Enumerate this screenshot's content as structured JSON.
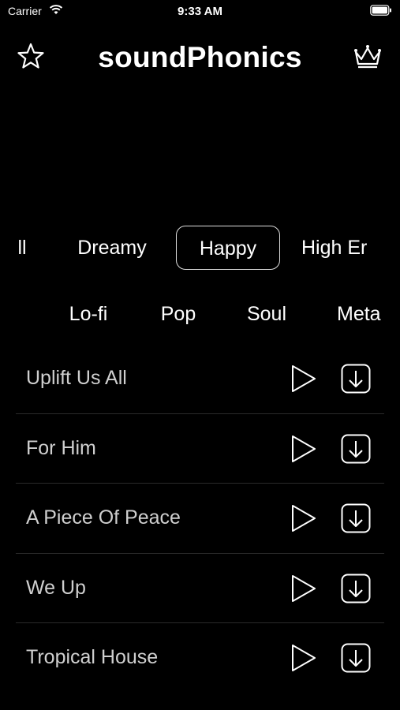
{
  "status": {
    "carrier": "Carrier",
    "time": "9:33 AM"
  },
  "header": {
    "title": "soundPhonics"
  },
  "genres_row1": [
    {
      "label": "ll"
    },
    {
      "label": "Dreamy"
    },
    {
      "label": "Happy",
      "selected": true
    },
    {
      "label": "High Er"
    }
  ],
  "genres_row2": [
    {
      "label": "Lo-fi"
    },
    {
      "label": "Pop"
    },
    {
      "label": "Soul"
    },
    {
      "label": "Meta"
    }
  ],
  "tracks": [
    {
      "title": "Uplift Us All"
    },
    {
      "title": "For Him"
    },
    {
      "title": "A Piece Of Peace"
    },
    {
      "title": "We Up"
    },
    {
      "title": "Tropical House"
    }
  ],
  "colors": {
    "background": "#000000",
    "text": "#ffffff",
    "track_text": "#cfcfcf",
    "divider": "#2b2b2b"
  },
  "icons": [
    "wifi-icon",
    "battery-icon",
    "star-icon",
    "crown-icon",
    "play-icon",
    "download-icon"
  ]
}
